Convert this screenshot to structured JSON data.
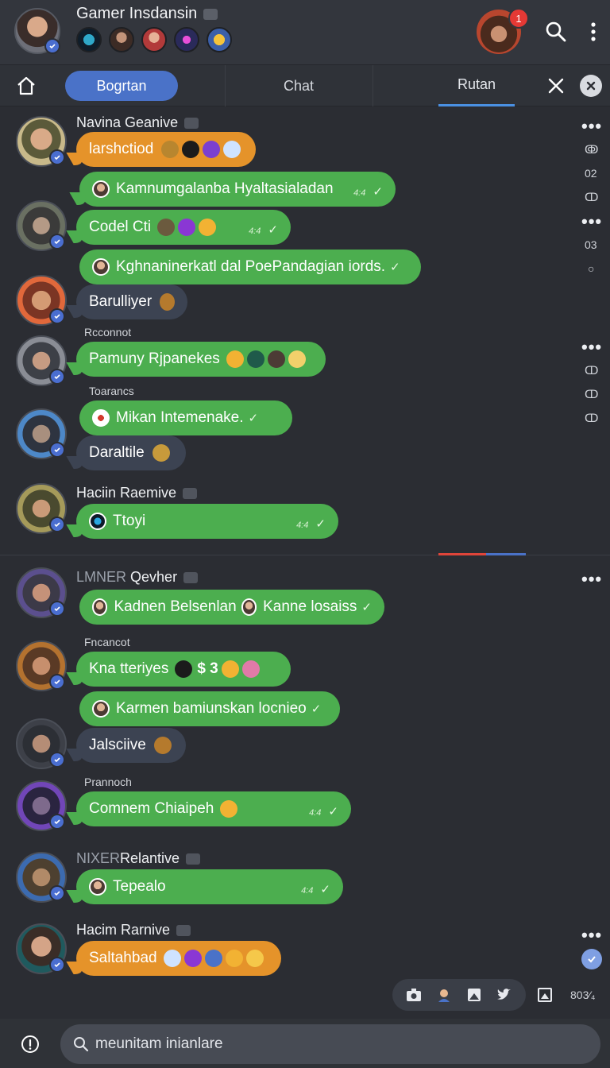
{
  "header": {
    "title": "Gamer Insdansin",
    "badge_count": "1"
  },
  "tabs": {
    "active": "Bogrtan",
    "chat": "Chat",
    "rutan": "Rutan"
  },
  "messages": {
    "m1_name": "Navina Geanive",
    "m1_b1": "larshctiod",
    "m2_b1": "Kamnumgalanba Hyaltasialadan",
    "m2_b2": "Codel Cti",
    "m2_b3": "Kghnaninerkatl dal PoePandagian iords.",
    "m3_b1": "Barulliyer",
    "m4_sub": "Rcconnot",
    "m4_b1": "Pamuny Rjpanekes",
    "m5_sub": "Toarancs",
    "m5_b1": "Mikan Intemenake.",
    "m5_b2": "Daraltile",
    "m6_name": "Haciin Raemive",
    "m6_b1": "Ttoyi",
    "m7_name_dim": "LMNER",
    "m7_name": "Qevher",
    "m7_b1a": "Kadnen Belsenlan",
    "m7_b1b": "Kanne losaiss",
    "m8_sub": "Fncancot",
    "m8_b1": "Kna tteriyes",
    "m8_b1_sym": "$ 3",
    "m8_b2": "Karmen bamiunskan locnieo",
    "m9_b1": "Jalsciive",
    "m10_sub": "Prannoch",
    "m10_b1": "Comnem Chiaipeh",
    "m11_name_dim": "NIXER",
    "m11_name": "Relantive",
    "m11_b1": "Tepealo",
    "m12_name": "Hacim Rarnive",
    "m12_b1": "Saltahbad"
  },
  "side_icons": {
    "s1": "ↂ",
    "s2": "02",
    "s3": "ↀ",
    "s4": "03",
    "s5": "○",
    "s6": "ↀ",
    "s7": "ↀ",
    "s8": "ↀ"
  },
  "toolbar": {
    "zoom": "803⁄₄"
  },
  "composer": {
    "placeholder": "meunitam inianlare"
  },
  "colors": {
    "bubble_green": "#4cae4f",
    "bubble_orange": "#e5932a",
    "bubble_dark": "#3c4352",
    "accent_blue": "#4a72c8",
    "badge_red": "#e53935"
  }
}
